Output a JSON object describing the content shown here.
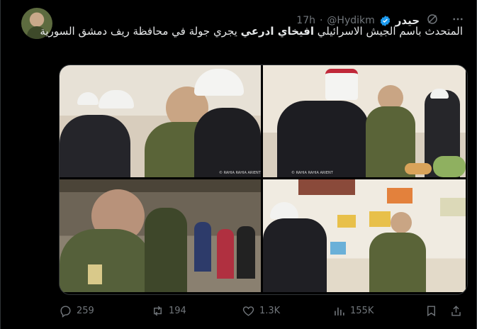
{
  "post": {
    "display_name": "حيدر",
    "handle": "@Hydikm",
    "separator": "·",
    "time": "17h",
    "text_before": "المتحدث باسم الجيش الاسرائيلي ",
    "text_bold": "افيخاي ادرعي",
    "text_after": " يجري جولة في محافظة ريف دمشق السورية",
    "photo_caption": "© RAHIA RAHIA ARIENT"
  },
  "actions": {
    "replies": "259",
    "reposts": "194",
    "likes": "1.3K",
    "views": "155K"
  },
  "icons": [
    "grok-icon",
    "more-icon",
    "verified-icon",
    "reply-icon",
    "repost-icon",
    "like-icon",
    "views-icon",
    "bookmark-icon",
    "share-icon"
  ],
  "colors": {
    "background": "#000000",
    "text": "#e7e9ea",
    "muted": "#71767b",
    "verified": "#1d9bf0"
  }
}
